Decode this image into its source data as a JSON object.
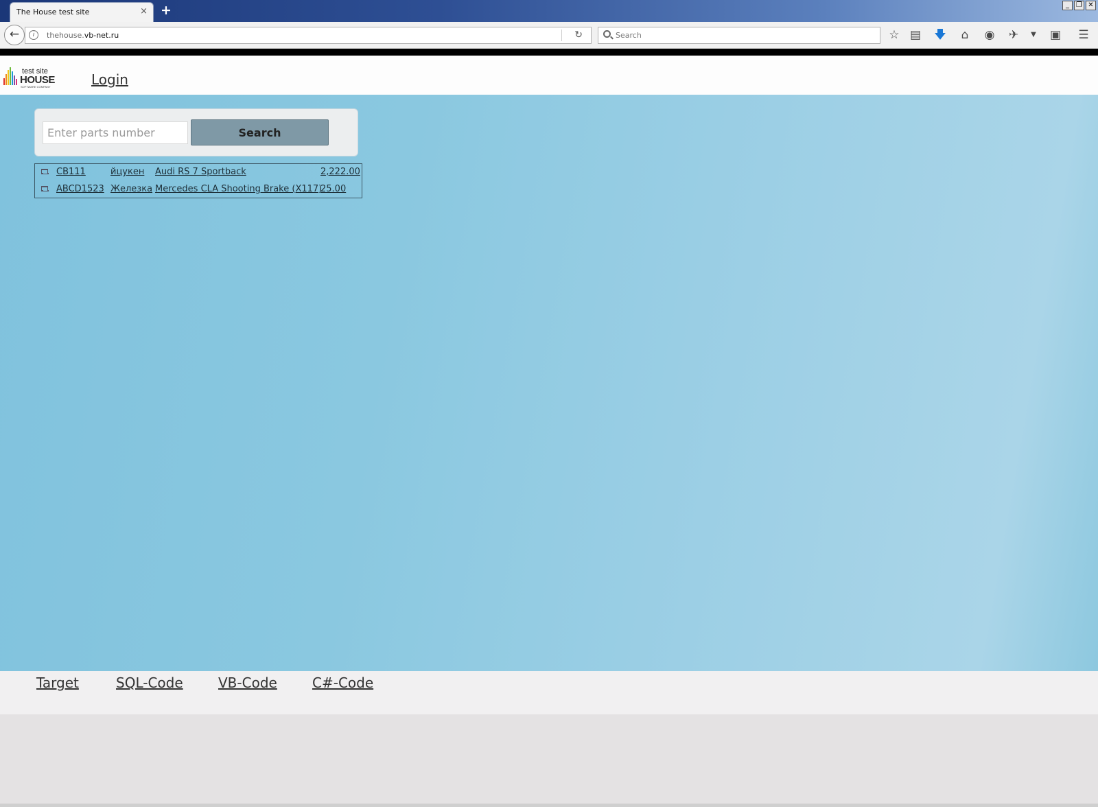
{
  "browser": {
    "tab_title": "The House test site",
    "tab_close": "×",
    "new_tab": "+",
    "url_host_prefix": "thehouse.",
    "url_host": "vb-net.ru",
    "search_placeholder": "Search",
    "window_controls": [
      "_",
      "❐",
      "✕"
    ]
  },
  "site": {
    "logo": {
      "top": "test site",
      "main": "HOUSE",
      "sub": "SOFTWARE COMPANY",
      "bar_colors": [
        "#e0322b",
        "#f08c1e",
        "#f3c51b",
        "#6dbb3a",
        "#1e9ad6",
        "#7b4ea3",
        "#d6337a"
      ]
    },
    "nav_login": "Login"
  },
  "search": {
    "placeholder": "Enter parts number",
    "button_label": "Search"
  },
  "results": [
    {
      "part": "CB111",
      "brand": "йцукен",
      "model": "Audi RS 7 Sportback",
      "price": "2,222.00"
    },
    {
      "part": "ABCD1523",
      "brand": "Железка",
      "model": "Mercedes CLA Shooting Brake (X117)",
      "price": "25.00"
    }
  ],
  "footer": {
    "links": [
      "Target",
      "SQL-Code",
      "VB-Code",
      "C#-Code"
    ]
  },
  "colors": {
    "content_bg": "#8ac8e0",
    "search_button": "#7f99a6",
    "titlebar": "#2e4f94"
  }
}
